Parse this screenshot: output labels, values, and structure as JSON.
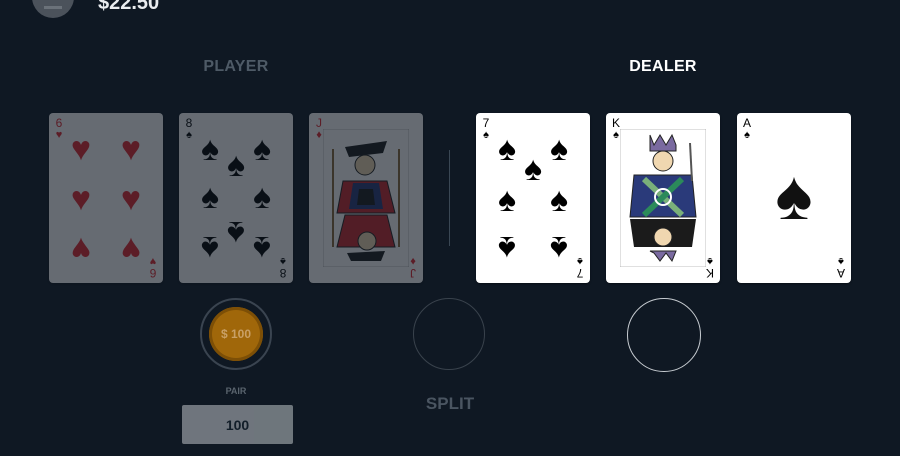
{
  "header": {
    "balance": "$22.50"
  },
  "player": {
    "title": "PLAYER",
    "cards": [
      {
        "rank": "6",
        "suit": "♥",
        "color": "#e3262f"
      },
      {
        "rank": "8",
        "suit": "♠",
        "color": "#000000"
      },
      {
        "rank": "J",
        "suit": "♦",
        "color": "#e3262f"
      }
    ]
  },
  "dealer": {
    "title": "DEALER",
    "cards": [
      {
        "rank": "7",
        "suit": "♠",
        "color": "#000000"
      },
      {
        "rank": "K",
        "suit": "♠",
        "color": "#000000"
      },
      {
        "rank": "A",
        "suit": "♠",
        "color": "#000000"
      }
    ]
  },
  "bets": {
    "pair_chip": "$ 100",
    "pair_label": "PAIR",
    "pair_value": "100",
    "split_label": "SPLIT"
  },
  "colors": {
    "background": "#0f1823",
    "chip": "#a0670a"
  },
  "icons": {
    "menu": "menu-icon"
  }
}
